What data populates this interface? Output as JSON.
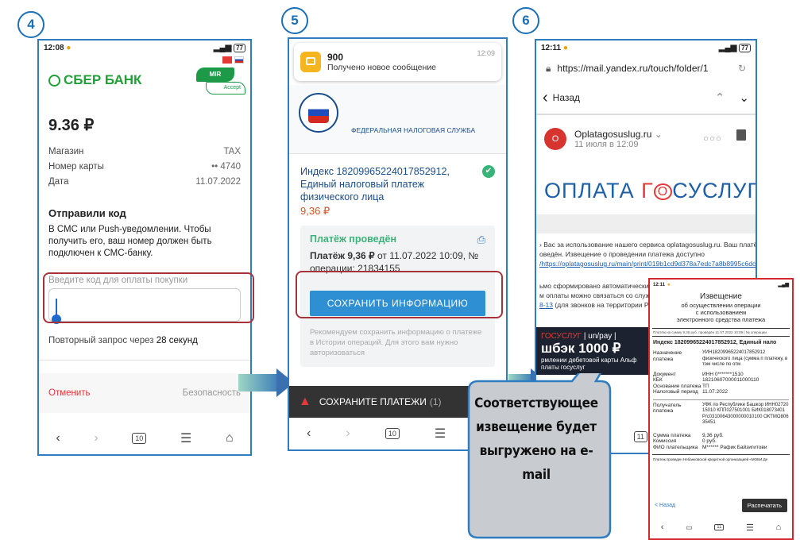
{
  "steps": [
    "4",
    "5",
    "6"
  ],
  "phone4": {
    "time": "12:08",
    "battery": "77",
    "bank_logo": "СБЕР БАНК",
    "mir_label": "MIR",
    "accept_label": "Accept",
    "amount": "9.36 ₽",
    "rows": [
      {
        "label": "Магазин",
        "value": "TAX"
      },
      {
        "label": "Номер карты",
        "value": "•• 4740"
      },
      {
        "label": "Дата",
        "value": "11.07.2022"
      }
    ],
    "heading": "Отправили код",
    "description": "В СМС или Push-уведомлении. Чтобы получить его, ваш номер должен быть подключен к СМС-банку.",
    "code_placeholder": "Введите код для оплаты покупки",
    "resend_prefix": "Повторный запрос через",
    "resend_time": "28 секунд",
    "cancel": "Отменить",
    "security": "Безопасность",
    "tabs_count": "10"
  },
  "phone5": {
    "notif_sender": "900",
    "notif_time": "12:09",
    "notif_text": "Получено новое сообщение",
    "agency": "ФЕДЕРАЛЬНАЯ НАЛОГОВАЯ СЛУЖБА",
    "payment_title": "Индекс 18209965224017852912, Единый налоговый платеж физического лица",
    "payment_amount": "9,36 ₽",
    "status": "Платёж проведён",
    "details_bold": "Платёж 9,36 ₽",
    "details_rest": " от 11.07.2022 10:09, № операции: 21834155",
    "save_button": "СОХРАНИТЬ ИНФОРМАЦИЮ",
    "hint": "Рекомендуем сохранить информацию о платеже в Истории операций. Для этого вам нужно авторизоваться",
    "snackbar": "СОХРАНИТЕ ПЛАТЕЖИ",
    "snackbar_count": "(1)",
    "tabs_count": "10"
  },
  "phone6": {
    "time": "12:11",
    "battery": "77",
    "url": "https://mail.yandex.ru/touch/folder/1",
    "back": "Назад",
    "sender": "Oplatagosuslug.ru",
    "sender_initial": "O",
    "date": "11 июля в 12:09",
    "brand_a": "ОПЛАТА ",
    "brand_b": "Г",
    "brand_c": "О",
    "brand_d": "СУСЛУГ",
    "body1": "› Вас за использование нашего сервиса oplatagosuslug.ru. Ваш платё",
    "body2": "оведён. Извещение о проведении платежа доступно",
    "link1": "/https://oplatagosuslug.ru/main/print/019b1cd9d378a7edc7a8b8995c6dc",
    "body3": "ьмо сформировано автоматически,",
    "body4": "м оплаты можно связаться со служ",
    "link2": "8-13",
    "body5": " (для звонков на территории Рос",
    "banner_brand": "ГОСУСЛУГ",
    "banner_mid": "| un/pay |",
    "banner_big": "шбэк 1000 ₽",
    "banner_small1": "рмлении дебетовой карты Альф",
    "banner_small2": "платы госуслуг",
    "tabs_count": "11"
  },
  "callout": "Соответствующее извещение будет выгружено на e-mail",
  "receipt": {
    "time": "12:11",
    "title": "Извещение",
    "subtitle1": "об осуществлении операции",
    "subtitle2": "с использованием",
    "subtitle3": "электронного средства платежа",
    "meta": "Платёж на сумму 9,36 руб. проведён 11.07.2022 10:09 | № операции",
    "index": "Индекс 18209965224017852912, Единый нало",
    "rows": [
      {
        "label": "Назначение платежа",
        "value": "УИН18209965224017852912 физического лица (сумма п платежу, в том числе по отм"
      },
      {
        "label": "Документ",
        "value": "ИНН 0*******1510"
      },
      {
        "label": "КБК",
        "value": "18210607000011000110"
      },
      {
        "label": "Основание платежа",
        "value": "ТП"
      },
      {
        "label": "Налоговый период",
        "value": "11.07.2022"
      },
      {
        "label": "Получатель платежа",
        "value": "УФК по Республике Башкор ИНН0272015010 КПП027501001 БИК018073401 Р/с03100643000000010100 ОКТМО80635451"
      },
      {
        "label": "Сумма платежа",
        "value": "9,36 руб."
      },
      {
        "label": "Комиссия",
        "value": "0 руб."
      },
      {
        "label": "ФИО плательщика",
        "value": "М****** Рафик Байзигитови"
      }
    ],
    "footer": "Платеж проведен Небанковской кредитной организацией «МОБИ.Де",
    "back": "< Назад",
    "print": "Распечатать",
    "tabs_count": "11"
  }
}
